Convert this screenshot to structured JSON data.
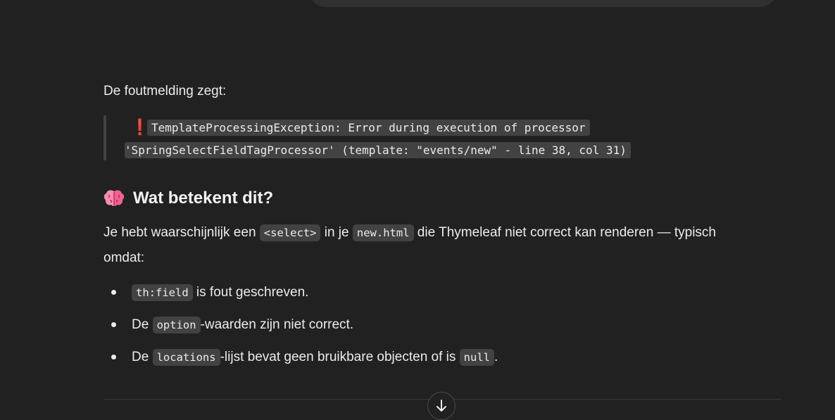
{
  "message": {
    "intro": "De foutmelding zegt:",
    "quote": {
      "line1": "TemplateProcessingException: Error during execution of processor",
      "line2": "'SpringSelectFieldTagProcessor' (template: \"events/new\" - line 38, col 31)"
    },
    "heading": "Wat betekent dit?",
    "paragraph": {
      "t1": "Je hebt waarschijnlijk een ",
      "c1": "<select>",
      "t2": " in je ",
      "c2": "new.html",
      "t3": " die Thymeleaf niet correct kan renderen — typisch omdat:"
    },
    "bullets": [
      {
        "code": "th:field",
        "after": " is fout geschreven."
      },
      {
        "before": "De ",
        "code": "option",
        "after": "-waarden zijn niet correct."
      },
      {
        "before": "De ",
        "code": "locations",
        "after": "-lijst bevat geen bruikbare objecten of is ",
        "code2": "null",
        "after2": "."
      }
    ]
  },
  "icons": {
    "warning": "exclamation-icon",
    "heading": "brain-icon",
    "scroll": "arrow-down-icon"
  },
  "colors": {
    "background": "#212121",
    "text": "#ececec",
    "code_bg": "#424242",
    "exclamation": "#e5245c"
  }
}
